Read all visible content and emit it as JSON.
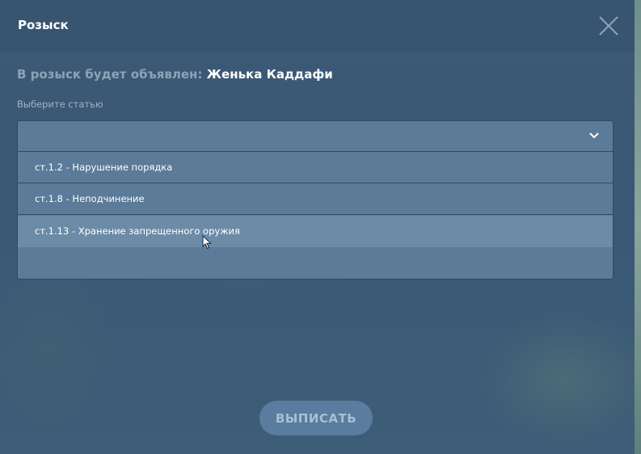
{
  "dialog": {
    "title": "Розыск",
    "close_icon": "close-icon"
  },
  "wanted": {
    "prefix": "В розыск будет объявлен:",
    "name": "Женька Каддафи"
  },
  "article_select": {
    "label": "Выберите статью",
    "selected": "",
    "chevron_icon": "chevron-down-icon",
    "options": [
      "ст.1.2 - Нарушение порядка",
      "ст.1.8 - Неподчинение",
      "ст.1.13 - Хранение запрещенного оружия"
    ],
    "hovered_option_index": 2
  },
  "submit": {
    "label": "ВЫПИСАТЬ"
  },
  "colors": {
    "panel": "#375571",
    "select_bg": "#5b7b98",
    "option_hover": "#6c8ba6",
    "button_bg": "#5a7d9f",
    "text_muted": "#8da3b8"
  }
}
